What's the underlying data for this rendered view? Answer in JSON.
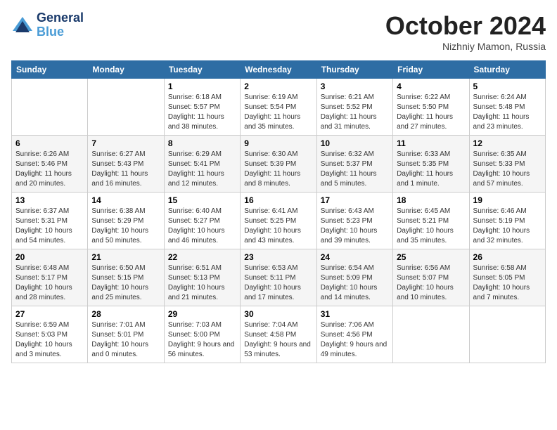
{
  "header": {
    "logo_line1": "General",
    "logo_line2": "Blue",
    "month_title": "October 2024",
    "subtitle": "Nizhniy Mamon, Russia"
  },
  "weekdays": [
    "Sunday",
    "Monday",
    "Tuesday",
    "Wednesday",
    "Thursday",
    "Friday",
    "Saturday"
  ],
  "weeks": [
    [
      {
        "day": "",
        "info": ""
      },
      {
        "day": "",
        "info": ""
      },
      {
        "day": "1",
        "info": "Sunrise: 6:18 AM\nSunset: 5:57 PM\nDaylight: 11 hours and 38 minutes."
      },
      {
        "day": "2",
        "info": "Sunrise: 6:19 AM\nSunset: 5:54 PM\nDaylight: 11 hours and 35 minutes."
      },
      {
        "day": "3",
        "info": "Sunrise: 6:21 AM\nSunset: 5:52 PM\nDaylight: 11 hours and 31 minutes."
      },
      {
        "day": "4",
        "info": "Sunrise: 6:22 AM\nSunset: 5:50 PM\nDaylight: 11 hours and 27 minutes."
      },
      {
        "day": "5",
        "info": "Sunrise: 6:24 AM\nSunset: 5:48 PM\nDaylight: 11 hours and 23 minutes."
      }
    ],
    [
      {
        "day": "6",
        "info": "Sunrise: 6:26 AM\nSunset: 5:46 PM\nDaylight: 11 hours and 20 minutes."
      },
      {
        "day": "7",
        "info": "Sunrise: 6:27 AM\nSunset: 5:43 PM\nDaylight: 11 hours and 16 minutes."
      },
      {
        "day": "8",
        "info": "Sunrise: 6:29 AM\nSunset: 5:41 PM\nDaylight: 11 hours and 12 minutes."
      },
      {
        "day": "9",
        "info": "Sunrise: 6:30 AM\nSunset: 5:39 PM\nDaylight: 11 hours and 8 minutes."
      },
      {
        "day": "10",
        "info": "Sunrise: 6:32 AM\nSunset: 5:37 PM\nDaylight: 11 hours and 5 minutes."
      },
      {
        "day": "11",
        "info": "Sunrise: 6:33 AM\nSunset: 5:35 PM\nDaylight: 11 hours and 1 minute."
      },
      {
        "day": "12",
        "info": "Sunrise: 6:35 AM\nSunset: 5:33 PM\nDaylight: 10 hours and 57 minutes."
      }
    ],
    [
      {
        "day": "13",
        "info": "Sunrise: 6:37 AM\nSunset: 5:31 PM\nDaylight: 10 hours and 54 minutes."
      },
      {
        "day": "14",
        "info": "Sunrise: 6:38 AM\nSunset: 5:29 PM\nDaylight: 10 hours and 50 minutes."
      },
      {
        "day": "15",
        "info": "Sunrise: 6:40 AM\nSunset: 5:27 PM\nDaylight: 10 hours and 46 minutes."
      },
      {
        "day": "16",
        "info": "Sunrise: 6:41 AM\nSunset: 5:25 PM\nDaylight: 10 hours and 43 minutes."
      },
      {
        "day": "17",
        "info": "Sunrise: 6:43 AM\nSunset: 5:23 PM\nDaylight: 10 hours and 39 minutes."
      },
      {
        "day": "18",
        "info": "Sunrise: 6:45 AM\nSunset: 5:21 PM\nDaylight: 10 hours and 35 minutes."
      },
      {
        "day": "19",
        "info": "Sunrise: 6:46 AM\nSunset: 5:19 PM\nDaylight: 10 hours and 32 minutes."
      }
    ],
    [
      {
        "day": "20",
        "info": "Sunrise: 6:48 AM\nSunset: 5:17 PM\nDaylight: 10 hours and 28 minutes."
      },
      {
        "day": "21",
        "info": "Sunrise: 6:50 AM\nSunset: 5:15 PM\nDaylight: 10 hours and 25 minutes."
      },
      {
        "day": "22",
        "info": "Sunrise: 6:51 AM\nSunset: 5:13 PM\nDaylight: 10 hours and 21 minutes."
      },
      {
        "day": "23",
        "info": "Sunrise: 6:53 AM\nSunset: 5:11 PM\nDaylight: 10 hours and 17 minutes."
      },
      {
        "day": "24",
        "info": "Sunrise: 6:54 AM\nSunset: 5:09 PM\nDaylight: 10 hours and 14 minutes."
      },
      {
        "day": "25",
        "info": "Sunrise: 6:56 AM\nSunset: 5:07 PM\nDaylight: 10 hours and 10 minutes."
      },
      {
        "day": "26",
        "info": "Sunrise: 6:58 AM\nSunset: 5:05 PM\nDaylight: 10 hours and 7 minutes."
      }
    ],
    [
      {
        "day": "27",
        "info": "Sunrise: 6:59 AM\nSunset: 5:03 PM\nDaylight: 10 hours and 3 minutes."
      },
      {
        "day": "28",
        "info": "Sunrise: 7:01 AM\nSunset: 5:01 PM\nDaylight: 10 hours and 0 minutes."
      },
      {
        "day": "29",
        "info": "Sunrise: 7:03 AM\nSunset: 5:00 PM\nDaylight: 9 hours and 56 minutes."
      },
      {
        "day": "30",
        "info": "Sunrise: 7:04 AM\nSunset: 4:58 PM\nDaylight: 9 hours and 53 minutes."
      },
      {
        "day": "31",
        "info": "Sunrise: 7:06 AM\nSunset: 4:56 PM\nDaylight: 9 hours and 49 minutes."
      },
      {
        "day": "",
        "info": ""
      },
      {
        "day": "",
        "info": ""
      }
    ]
  ]
}
